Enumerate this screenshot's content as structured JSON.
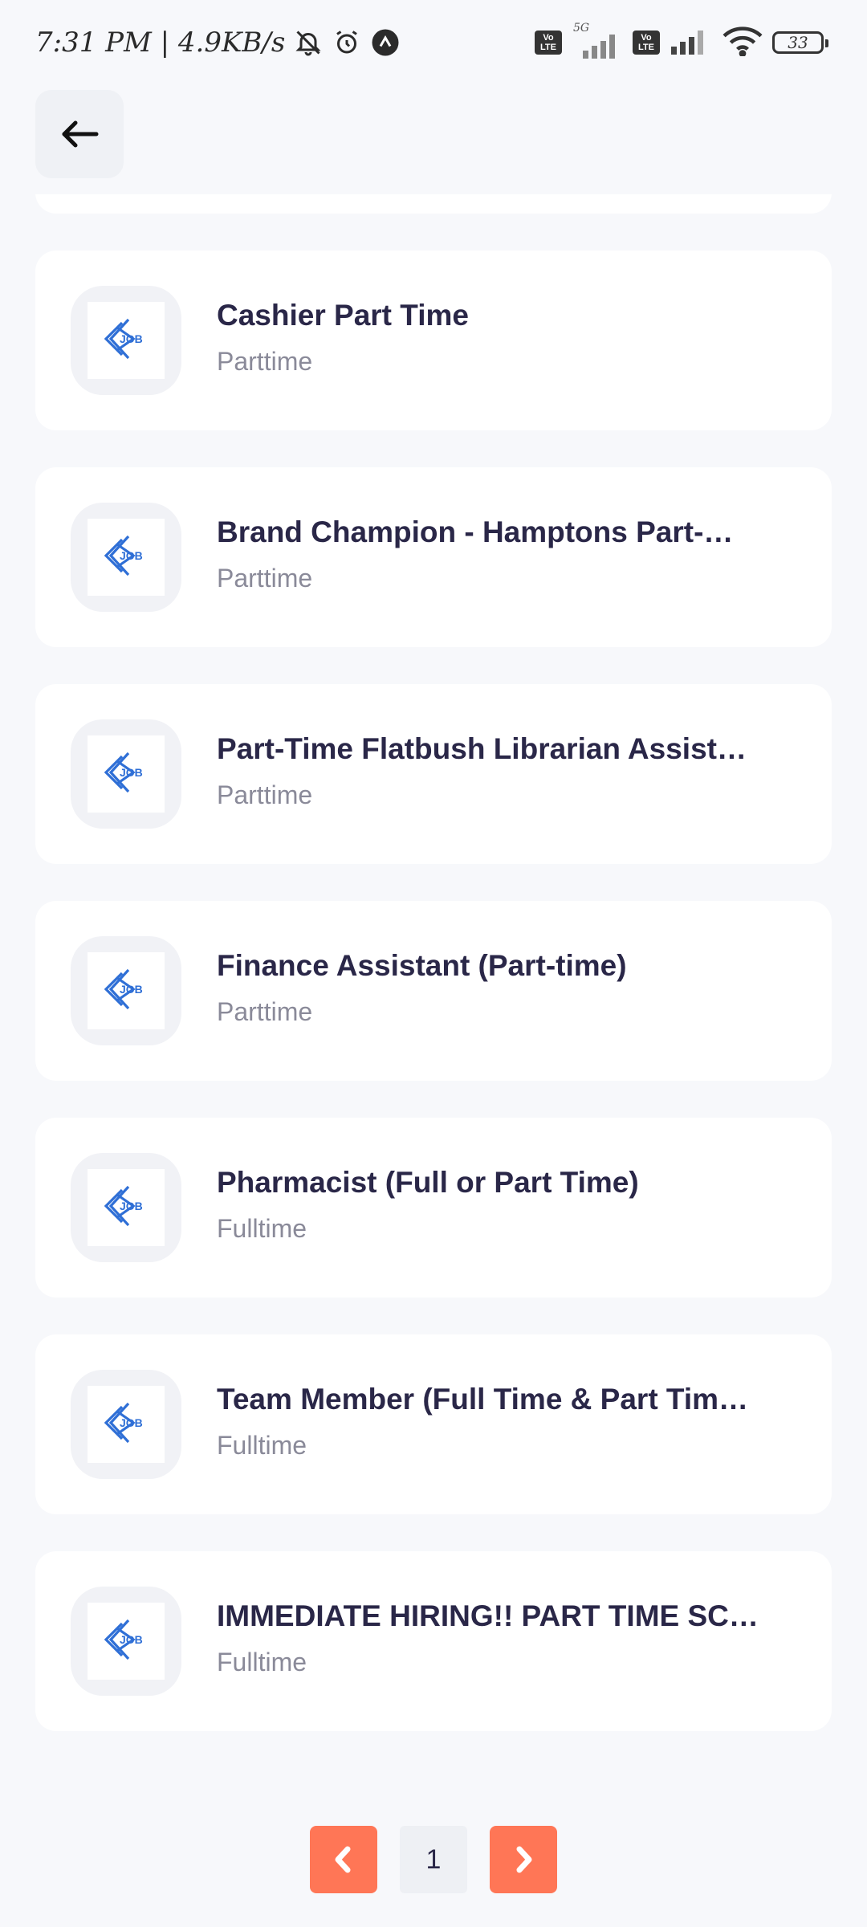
{
  "status_bar": {
    "time_speed": "7:31 PM | 4.9KB/s",
    "network_5g": "5G",
    "volte_1": "Vo LTE",
    "volte_2": "Vo LTE",
    "battery": "33",
    "icons": [
      "mute-icon",
      "alarm-icon",
      "app-notification-icon",
      "signal-icon",
      "wifi-icon",
      "battery-icon"
    ]
  },
  "header": {
    "back_icon": "arrow-left-icon"
  },
  "jobs": [
    {
      "title": "",
      "type": ""
    },
    {
      "title": "Cashier Part Time",
      "type": "Parttime"
    },
    {
      "title": "Brand Champion - Hamptons Part-…",
      "type": "Parttime"
    },
    {
      "title": "Part-Time Flatbush Librarian Assist…",
      "type": "Parttime"
    },
    {
      "title": "Finance Assistant (Part-time)",
      "type": "Parttime"
    },
    {
      "title": "Pharmacist (Full or Part Time)",
      "type": "Fulltime"
    },
    {
      "title": "Team Member (Full Time & Part Tim…",
      "type": "Fulltime"
    },
    {
      "title": "IMMEDIATE HIRING!! PART TIME  SC…",
      "type": "Fulltime"
    }
  ],
  "logo_text": "JOB",
  "pagination": {
    "current_page": "1",
    "prev_icon": "chevron-left-icon",
    "next_icon": "chevron-right-icon"
  },
  "colors": {
    "accent": "#ff7656",
    "title": "#2a2748",
    "subtitle": "#8a8a99",
    "logo_blue": "#2f6fd6",
    "background": "#f7f8fb"
  }
}
